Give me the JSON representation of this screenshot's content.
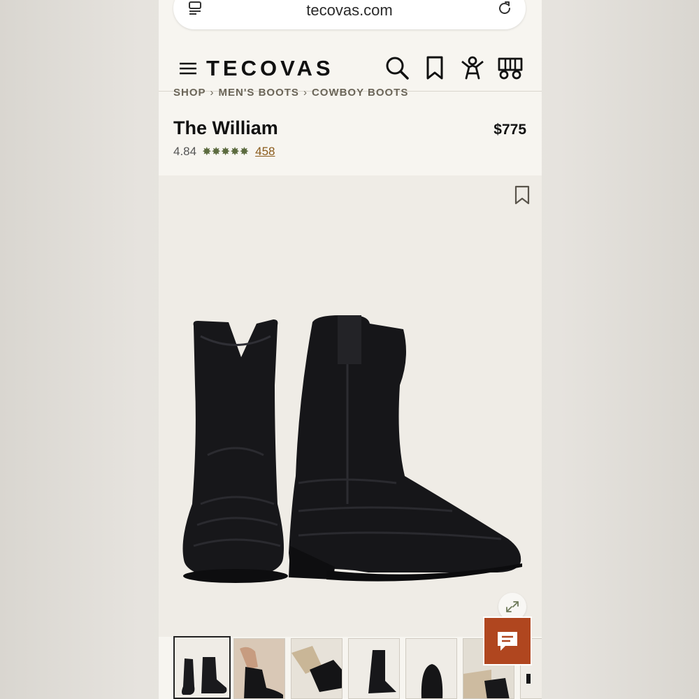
{
  "browser": {
    "url": "tecovas.com"
  },
  "header": {
    "logo": "TECOVAS"
  },
  "breadcrumb": [
    "SHOP",
    "MEN'S BOOTS",
    "COWBOY BOOTS"
  ],
  "product": {
    "title": "The William",
    "price": "$775",
    "rating": "4.84",
    "rating_value": 4.84,
    "stars": "✸✸✸✸✸",
    "review_count": "458"
  },
  "gallery": {
    "thumbnail_count": 7,
    "active_index": 0
  },
  "colors": {
    "accent": "#b0461f",
    "star": "#5b6a3e",
    "link": "#8a5a1a"
  }
}
